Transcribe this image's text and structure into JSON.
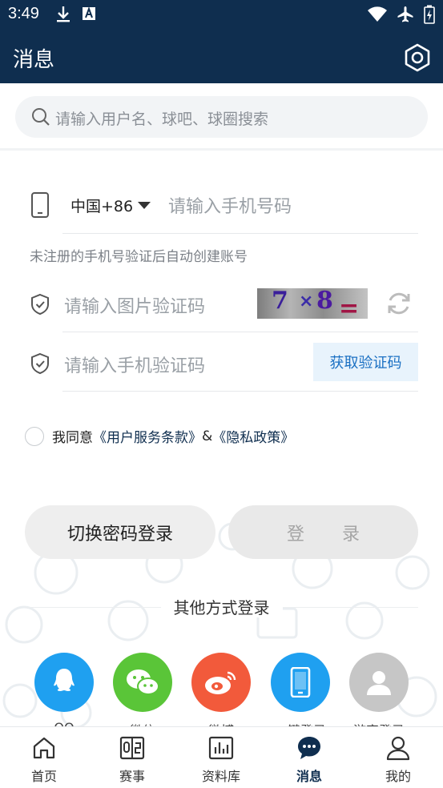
{
  "status_bar": {
    "time": "3:49"
  },
  "app_bar": {
    "title": "消息"
  },
  "search": {
    "placeholder": "请输入用户名、球吧、球圈搜索"
  },
  "phone_login": {
    "country_code": "中国+86",
    "phone_placeholder": "请输入手机号码",
    "hint": "未注册的手机号验证后自动创建账号",
    "image_code_placeholder": "请输入图片验证码",
    "captcha_text": "7 × 8 =",
    "sms_code_placeholder": "请输入手机验证码",
    "get_code_label": "获取验证码"
  },
  "agreement": {
    "prefix": "我同意",
    "terms": "《用户服务条款》",
    "and": "&",
    "privacy": "《隐私政策》"
  },
  "buttons": {
    "switch_password": "切换密码登录",
    "login": "登 录"
  },
  "other_login": {
    "title": "其他方式登录",
    "methods": [
      {
        "label": "QQ",
        "color": "#1fa0f0",
        "icon": "qq-icon"
      },
      {
        "label": "微信",
        "color": "#5ac538",
        "icon": "wechat-icon"
      },
      {
        "label": "微博",
        "color": "#f25a3b",
        "icon": "weibo-icon"
      },
      {
        "label": "一键登录",
        "color": "#1fa0f0",
        "icon": "phone-icon"
      },
      {
        "label": "游客登录",
        "color": "#c6c6c6",
        "icon": "guest-icon"
      }
    ]
  },
  "tabs": [
    {
      "label": "首页",
      "icon": "home-icon"
    },
    {
      "label": "赛事",
      "icon": "scoreboard-icon"
    },
    {
      "label": "资料库",
      "icon": "chart-icon"
    },
    {
      "label": "消息",
      "icon": "message-icon",
      "active": true
    },
    {
      "label": "我的",
      "icon": "profile-icon"
    }
  ]
}
